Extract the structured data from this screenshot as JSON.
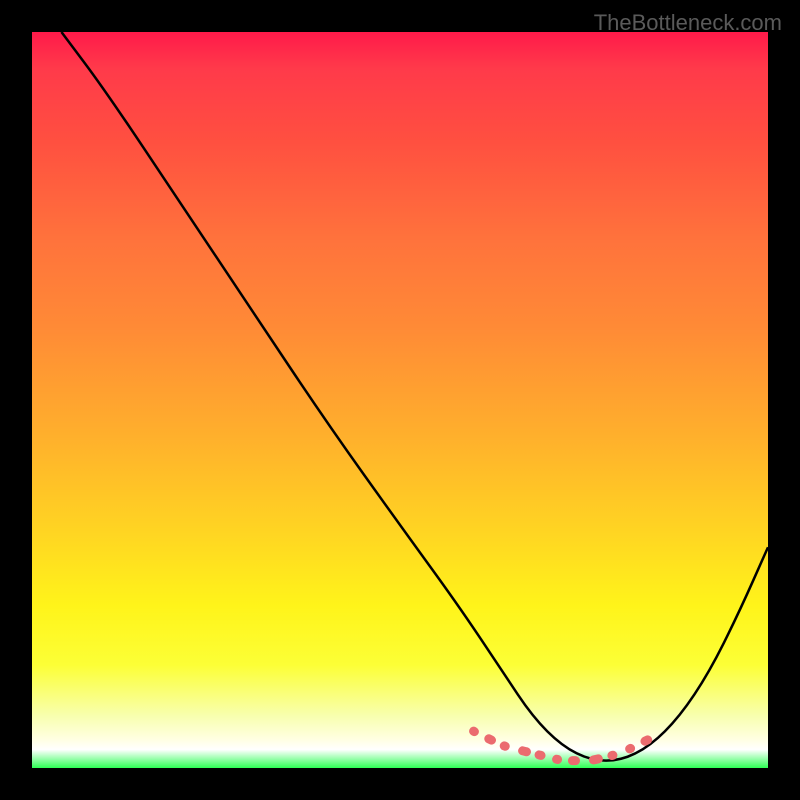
{
  "watermark": "TheBottleneck.com",
  "chart_data": {
    "type": "line",
    "title": "",
    "xlabel": "",
    "ylabel": "",
    "xrange": [
      0,
      100
    ],
    "yrange": [
      0,
      100
    ],
    "background": "red-yellow-green-vertical-gradient",
    "series": [
      {
        "name": "bottleneck-curve",
        "description": "Black V-shaped curve descending from upper-left to a minimum near x≈75 then rising toward upper-right",
        "x": [
          4,
          10,
          20,
          30,
          40,
          50,
          58,
          64,
          68,
          72,
          76,
          80,
          84,
          88,
          92,
          96,
          100
        ],
        "y": [
          100,
          92,
          77,
          62,
          47,
          33,
          22,
          13,
          7,
          3,
          1,
          1,
          3,
          7,
          13,
          21,
          30
        ]
      },
      {
        "name": "marker-dots",
        "description": "Salmon dotted marker segment highlighting the flat region near the minimum",
        "x": [
          60,
          62,
          64,
          66,
          68,
          70,
          72,
          74,
          76,
          78,
          80,
          82,
          84
        ],
        "y": [
          5,
          4,
          3,
          2.5,
          2,
          1.5,
          1,
          1,
          1,
          1.5,
          2,
          3,
          4
        ]
      }
    ]
  }
}
